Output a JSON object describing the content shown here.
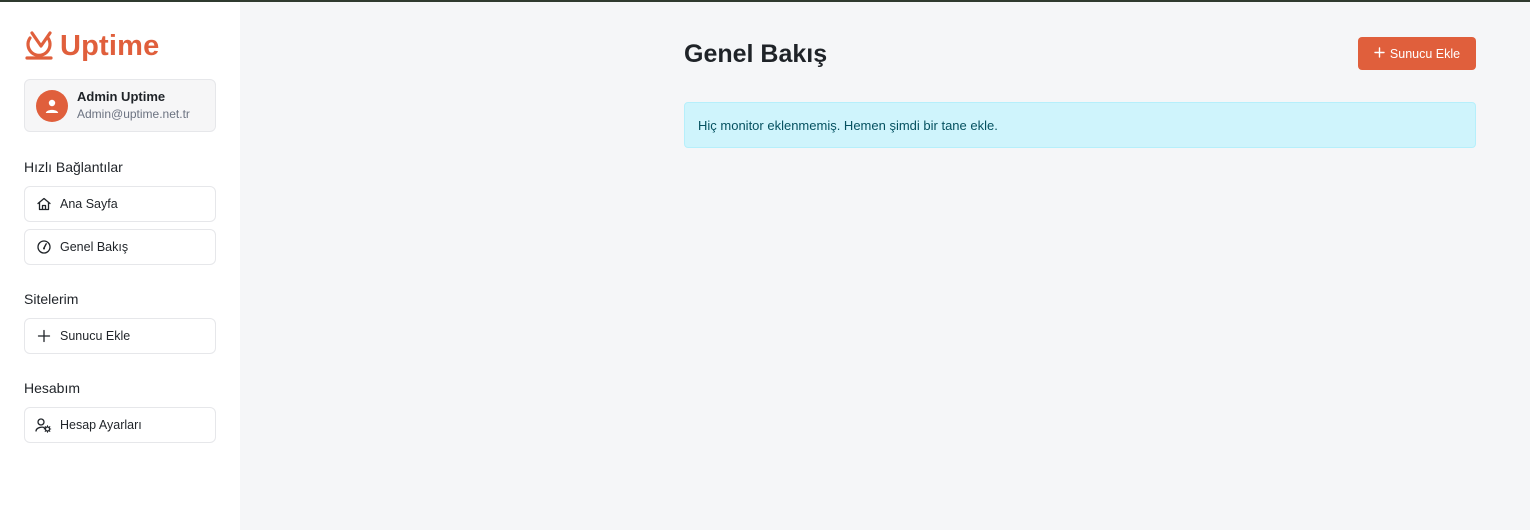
{
  "brand": {
    "name": "Uptime",
    "accent": "#e05f3c"
  },
  "user": {
    "name": "Admin Uptime",
    "email": "Admin@uptime.net.tr"
  },
  "sidebar": {
    "sections": [
      {
        "title": "Hızlı Bağlantılar",
        "items": [
          {
            "label": "Ana Sayfa",
            "icon": "home-icon"
          },
          {
            "label": "Genel Bakış",
            "icon": "gauge-icon"
          }
        ]
      },
      {
        "title": "Sitelerim",
        "items": [
          {
            "label": "Sunucu Ekle",
            "icon": "plus-icon"
          }
        ]
      },
      {
        "title": "Hesabım",
        "items": [
          {
            "label": "Hesap Ayarları",
            "icon": "user-settings-icon"
          }
        ]
      }
    ]
  },
  "main": {
    "title": "Genel Bakış",
    "add_button_label": "Sunucu Ekle",
    "alert_text": "Hiç monitor eklenmemiş. Hemen şimdi bir tane ekle."
  }
}
